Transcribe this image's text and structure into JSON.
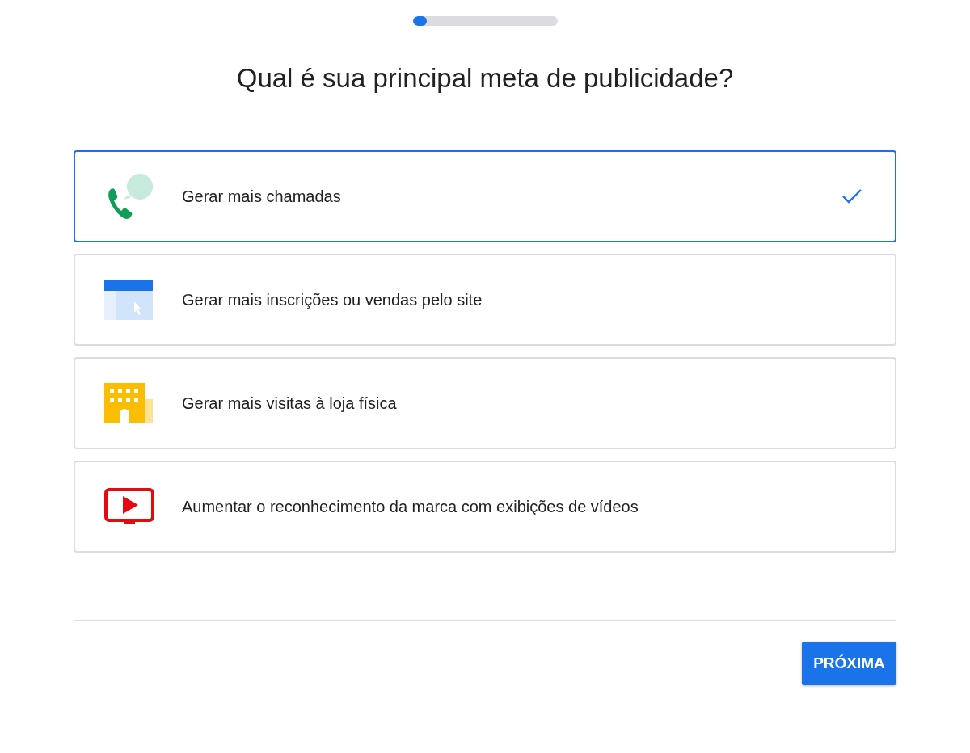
{
  "progress": {
    "level": 0.1
  },
  "title": "Qual é sua principal meta de publicidade?",
  "options": [
    {
      "kind": "calls",
      "label": "Gerar mais chamadas",
      "selected": true
    },
    {
      "kind": "website",
      "label": "Gerar mais inscrições ou vendas pelo site",
      "selected": false
    },
    {
      "kind": "store",
      "label": "Gerar mais visitas à loja física",
      "selected": false
    },
    {
      "kind": "video",
      "label": "Aumentar o reconhecimento da marca com exibições de vídeos",
      "selected": false
    }
  ],
  "next_button": "PRÓXIMA"
}
